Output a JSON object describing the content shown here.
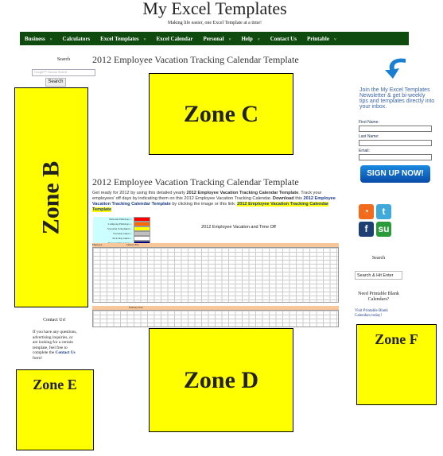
{
  "site": {
    "title": "My Excel Templates",
    "tagline": "Making life easier, one Excel Template at a time!"
  },
  "nav": [
    {
      "label": "Business",
      "dropdown": true
    },
    {
      "label": "Calculators",
      "dropdown": false
    },
    {
      "label": "Excel Templates",
      "dropdown": true
    },
    {
      "label": "Excel Calendar",
      "dropdown": false
    },
    {
      "label": "Personal",
      "dropdown": true
    },
    {
      "label": "Help",
      "dropdown": true
    },
    {
      "label": "Contact Us",
      "dropdown": false
    },
    {
      "label": "Printable",
      "dropdown": true
    }
  ],
  "left": {
    "search_label": "Search",
    "search_placeholder": "Google™ Custom Search",
    "search_button": "Search",
    "contact_title": "Contact Us!",
    "contact_text": "If you have any questions, advertising inquiries, or are looking for a certain template, feel free to complete the",
    "contact_link": "Contact Us",
    "contact_end": "form!"
  },
  "main": {
    "heading1": "2012 Employee Vacation Tracking Calendar Template",
    "heading2": "2012 Employee Vacation Tracking Calendar Template",
    "para": {
      "t1": "Get ready for 2012 by using this detailed yearly ",
      "b1": "2012 Employee Vacation Tracking Calendar Template",
      "t2": ". Track your employees' off days by indicating them on this 2012 Employee Vacation Tracking Calendar. ",
      "b2": "Download",
      "t3": " this ",
      "l1": "2012 Employee Vacation Tracking Calendar Template",
      "t4": " by clicking the image or this link: ",
      "l2": "2012 Employee Vacation Tracking Calendar Template"
    },
    "calendar": {
      "title": "2012 Employee Vacation and Time Off",
      "employee_col": "Employee",
      "months": [
        "January 2012",
        "February 2012"
      ],
      "legend": [
        {
          "label": "National Holidays =",
          "color": "#ff0000"
        },
        {
          "label": "Company Holidays =",
          "color": "#ff6600"
        },
        {
          "label": "Vacation Scheduled =",
          "color": "#ffff00"
        },
        {
          "label": "Vacation taken =",
          "color": "#c0c0c0"
        },
        {
          "label": "Sick Day taken =",
          "color": "#ffffff"
        },
        {
          "label": "Personal Day taken =",
          "color": "#000080"
        }
      ]
    }
  },
  "right": {
    "newsletter": "Join the My Excel Templates Newsletter & get bi-weekly tips and templates directly into your inbox.",
    "first_name": "First Name:",
    "last_name": "Last Name:",
    "email": "Email:",
    "signup": "SIGN UP NOW!",
    "social": [
      {
        "icon": "rss-icon",
        "glyph": "◔",
        "color": "#f26a1b"
      },
      {
        "icon": "twitter-icon",
        "glyph": "t",
        "color": "#3fa9d9"
      },
      {
        "icon": "facebook-icon",
        "glyph": "f",
        "color": "#1d3f73"
      },
      {
        "icon": "stumbleupon-icon",
        "glyph": "su",
        "color": "#2a9a3a"
      }
    ],
    "search_label": "Search",
    "search_placeholder": "Search & Hit Enter",
    "need_cal": "Need Printable Blank Calendars?",
    "visit": "Visit Printable Blank Calendars today!"
  },
  "zones": {
    "b": "Zone B",
    "c": "Zone C",
    "d": "Zone D",
    "e": "Zone E",
    "f": "Zone F"
  }
}
